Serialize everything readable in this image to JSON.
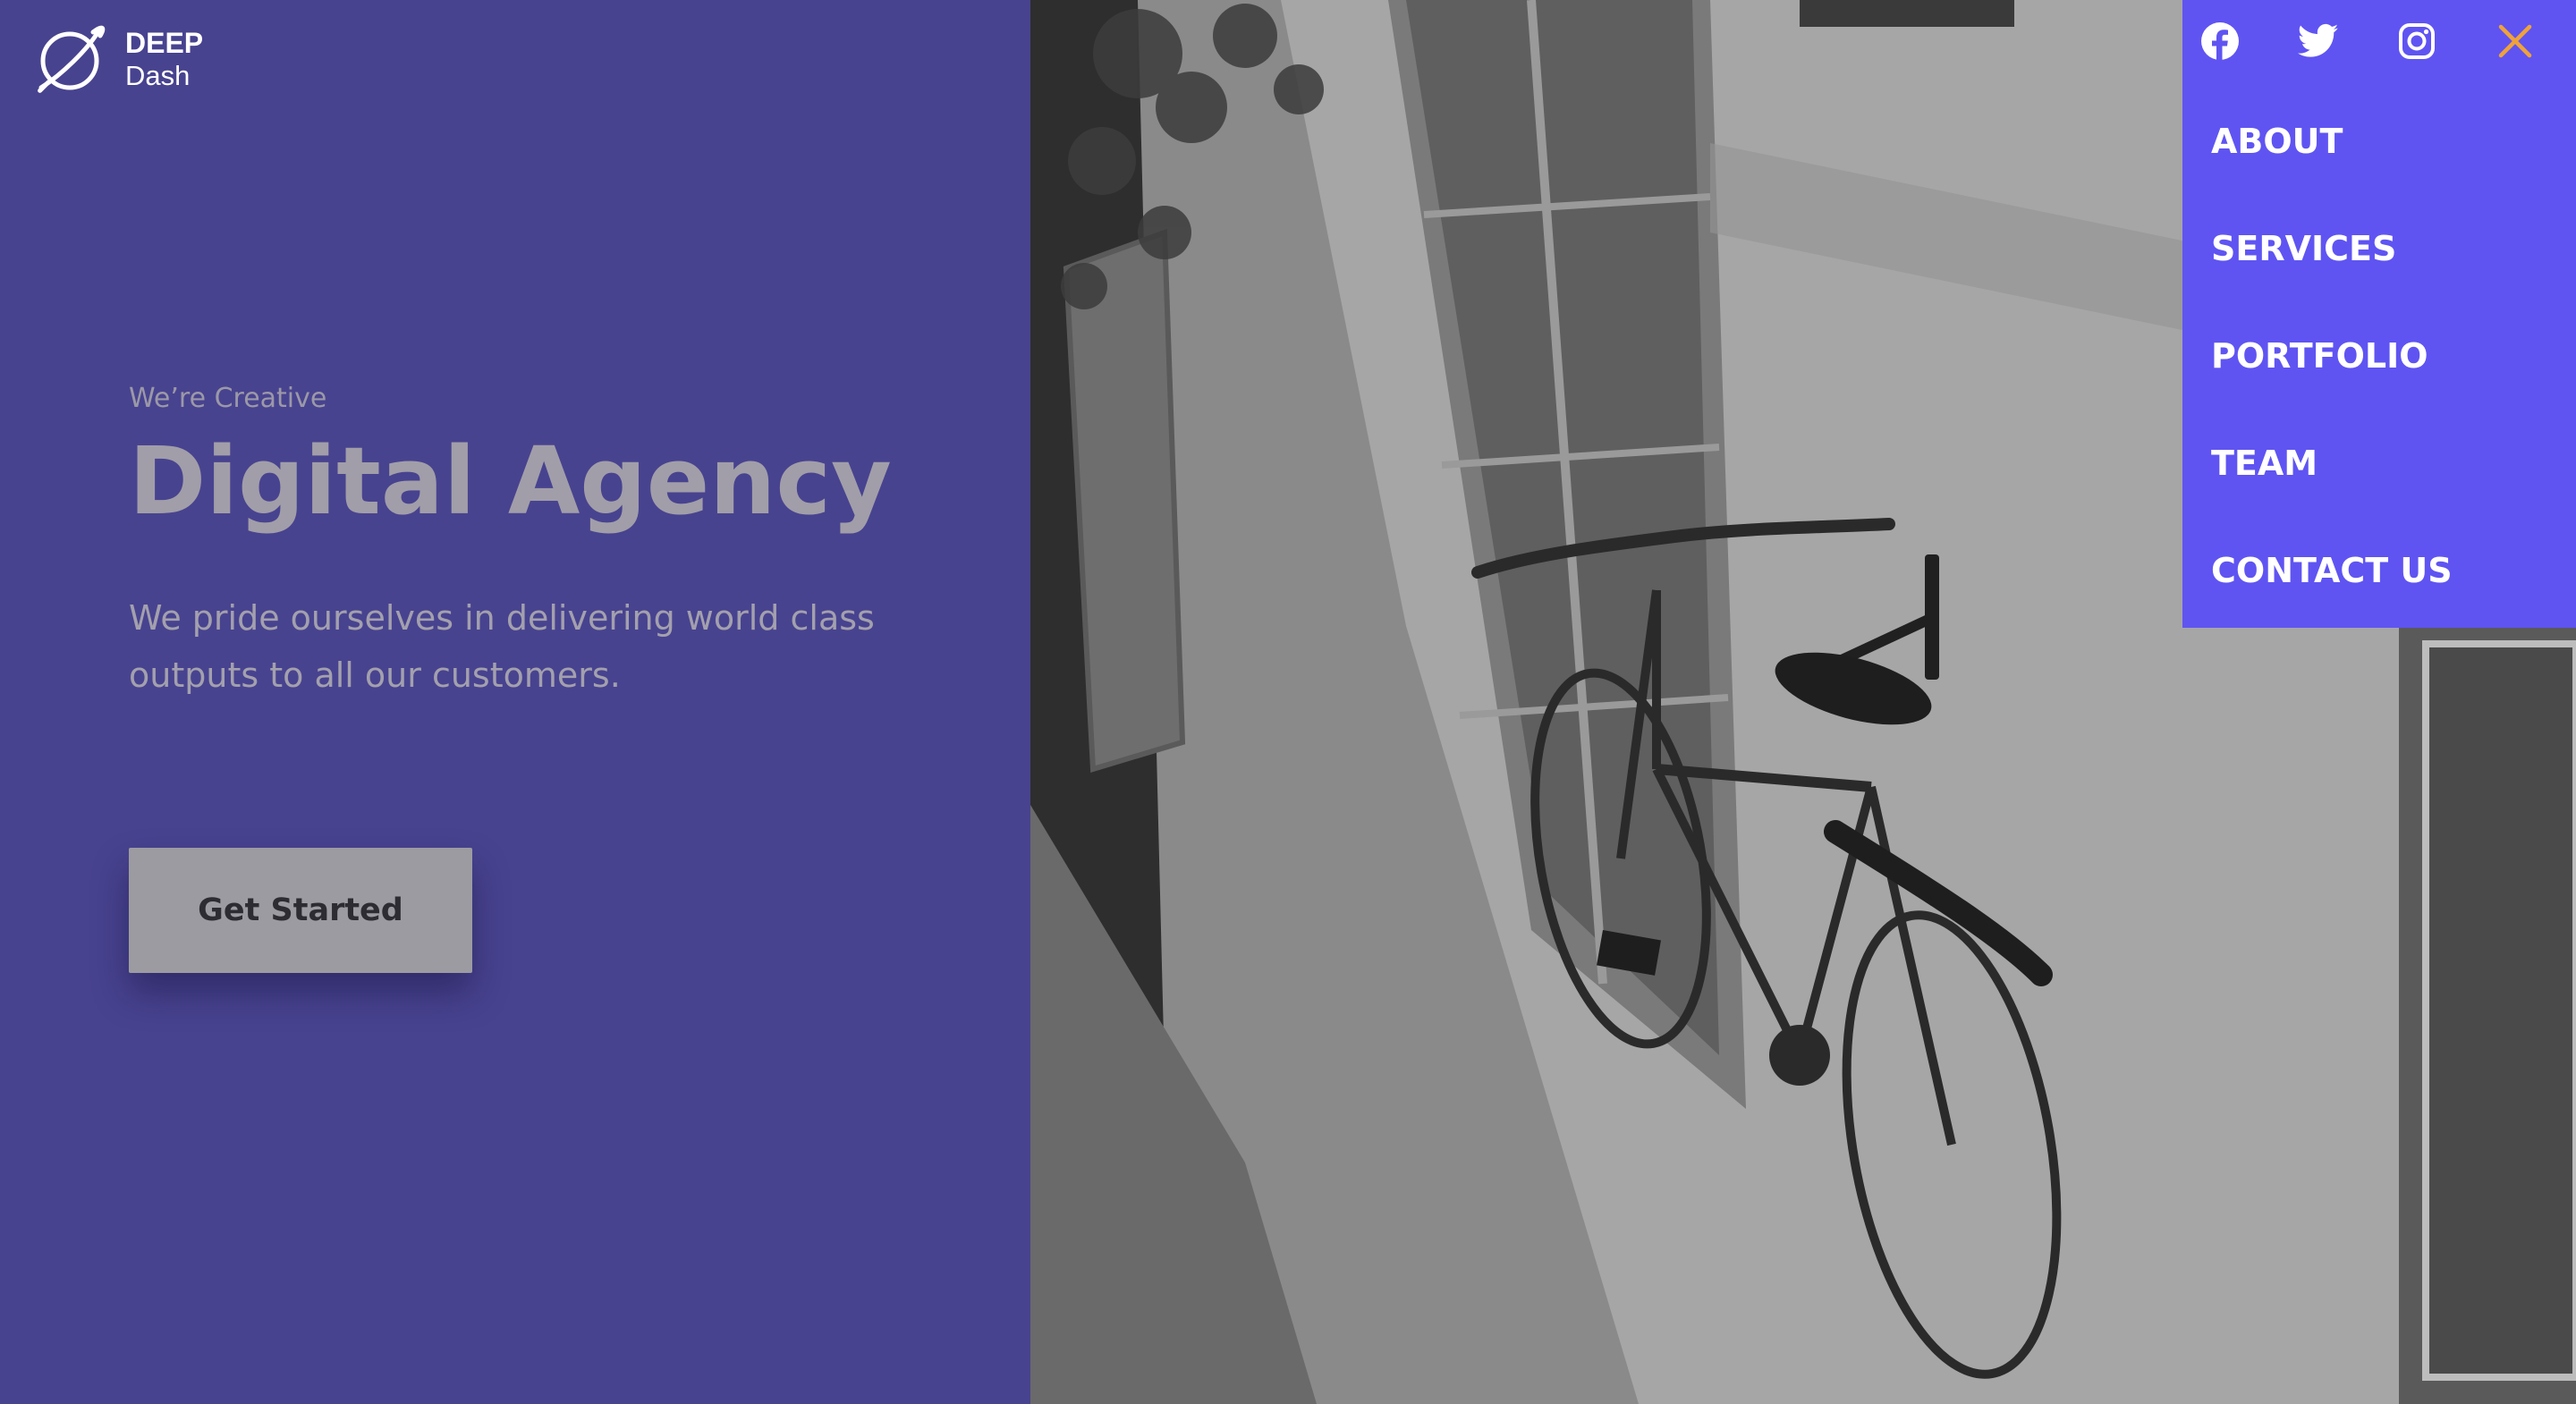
{
  "brand": {
    "name_line1": "DEEP",
    "name_line2": "Dash",
    "logo_icon": "planet-icon"
  },
  "hero": {
    "eyebrow": "We’re Creative",
    "headline": "Digital Agency",
    "description": "We pride ourselves in delivering world class outputs to all our customers.",
    "cta_label": "Get Started"
  },
  "menu": {
    "social_icons": [
      "facebook-icon",
      "twitter-icon",
      "instagram-icon"
    ],
    "close_icon": "close-icon",
    "items": [
      {
        "label": "ABOUT"
      },
      {
        "label": "SERVICES"
      },
      {
        "label": "PORTFOLIO"
      },
      {
        "label": "TEAM"
      },
      {
        "label": "CONTACT US"
      }
    ]
  },
  "colors": {
    "panel_bg": "#48438f",
    "menu_bg": "#5f54f2",
    "close_accent": "#f0a23a",
    "cta_bg": "#9c9ba1"
  }
}
